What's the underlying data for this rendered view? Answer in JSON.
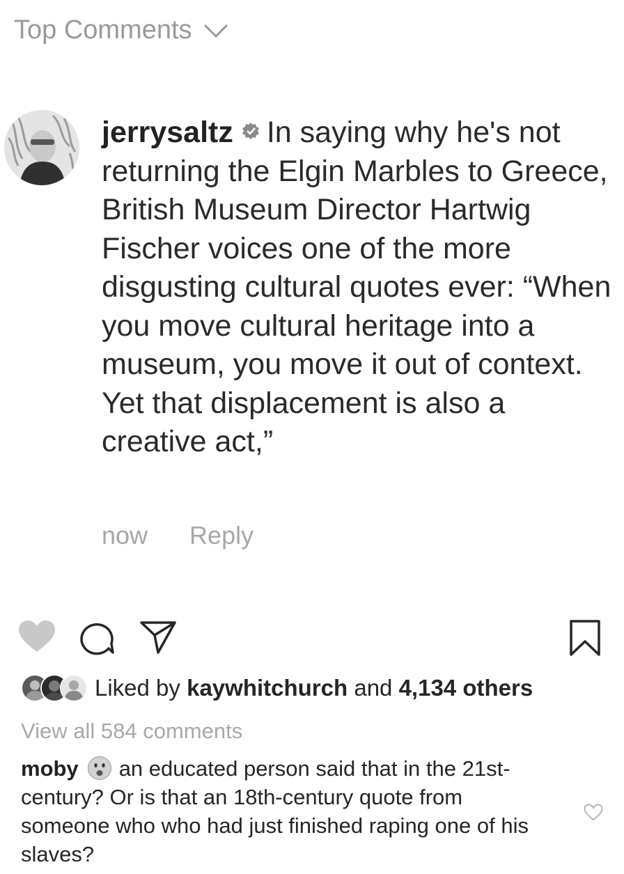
{
  "header": {
    "title": "Top Comments",
    "chevron_icon": "chevron-down-icon"
  },
  "comment": {
    "username": "jerrysaltz",
    "verified_icon": "verified-badge-icon",
    "text": "In saying why he's not returning the Elgin Marbles to Greece, British Museum Director Hartwig Fischer voices one of the more disgusting cultural quotes ever: “When you move cultural heritage into a museum, you move it out of context. Yet that displacement is also a creative act,”",
    "time": "now",
    "reply_label": "Reply"
  },
  "actions": {
    "like_icon": "heart-icon",
    "comment_icon": "comment-bubble-icon",
    "share_icon": "paper-plane-icon",
    "save_icon": "bookmark-icon"
  },
  "likes": {
    "prefix": "Liked by",
    "user": "kaywhitchurch",
    "and": "and",
    "others": "4,134 others"
  },
  "view_all": "View all 584 comments",
  "reply_comment": {
    "username": "moby",
    "emoji_icon": "frowning-face-emoji-icon",
    "text": "an educated person said that in the 21st-century? Or is that an 18th-century quote from someone who who had just finished raping one of his slaves?",
    "like_icon": "heart-outline-icon"
  },
  "colors": {
    "text": "#262626",
    "muted": "#a8a8a8",
    "header": "#9a9a9a",
    "liked_heart": "#c8c8c8"
  }
}
